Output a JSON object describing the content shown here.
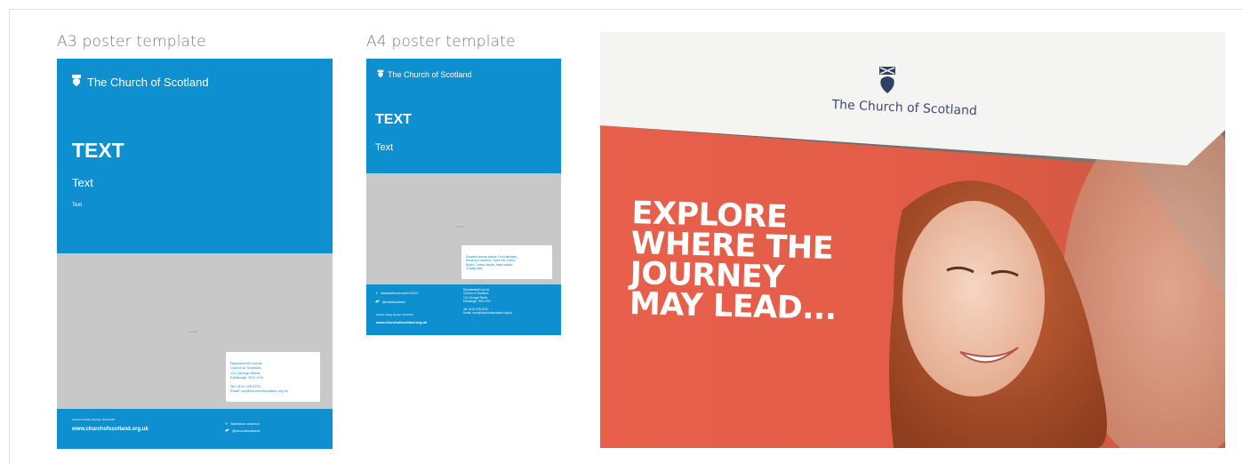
{
  "brand": {
    "name": "The Church of Scotland",
    "blue": "#0e8fcf",
    "grey": "#c8c8c8"
  },
  "a3": {
    "caption": "A3 poster template",
    "heading": "TEXT",
    "subheading": "Text",
    "body": "Text",
    "image_placeholder": "IMAGE",
    "contact": [
      "Department/Council,",
      "Church of Scotland,",
      "121 George Street,",
      "Edinburgh, EH2 4YN",
      "",
      "Tel: 0131 225 5722",
      "Email: xxx@churchofscotland.org.uk"
    ],
    "charity": "Scottish Charity Number: SC011353",
    "website": "www.churchofscotland.org.uk",
    "facebook": "facebook.com/cos",
    "twitter": "@churchscotland"
  },
  "a4": {
    "caption": "A4 poster template",
    "heading": "TEXT",
    "subheading": "Text",
    "image_placeholder": "IMAGE",
    "notes": [
      "Disabled access advice, Food allergies,",
      "Booking in advance, Extra info, Event",
      "Bright, Contact details, travel advice,",
      "Closing date"
    ],
    "facebook": "www.facebook.com/XXXXXX",
    "twitter": "@churchscotland",
    "charity": "Scottish Charity Number: SC011353",
    "website": "www.churchofscotland.org.uk",
    "contact": [
      "Department/Council,",
      "Church of Scotland,",
      "121 George Street,",
      "Edinburgh, EH2 4YN",
      "",
      "Tel: 0131 225 5722",
      "Email: xxxx@churchofscotland.org.uk"
    ]
  },
  "photo": {
    "brand": "The Church of Scotland",
    "headline": [
      "EXPLORE",
      "WHERE THE",
      "JOURNEY",
      "MAY LEAD..."
    ],
    "colors": {
      "red": "#e8604b",
      "paper": "#f4f4f2"
    }
  }
}
